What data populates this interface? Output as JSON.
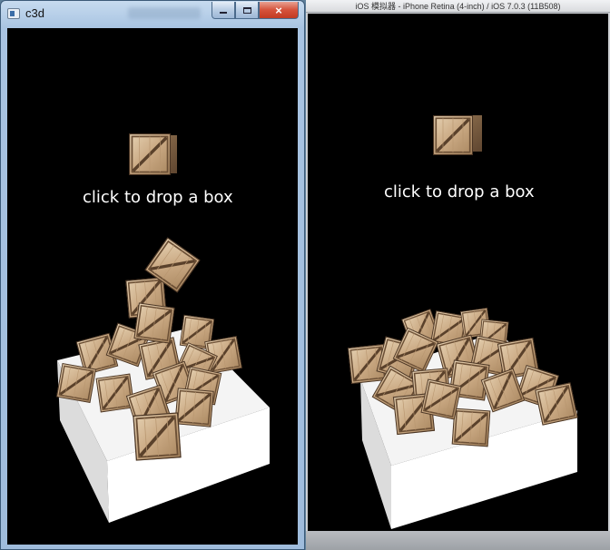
{
  "windows_app": {
    "title": "c3d",
    "controls": {
      "minimize": "minimize",
      "maximize": "maximize",
      "close": "×"
    },
    "prompt": "click to drop a box"
  },
  "ios_simulator": {
    "title": "iOS 模拟器 - iPhone Retina (4-inch) / iOS 7.0.3 (11B508)",
    "prompt": "click to drop a box"
  },
  "colors": {
    "background": "#000000",
    "box_light": "#d9c3a2",
    "box_dark": "#7a5f43",
    "platform": "#ffffff",
    "text": "#ffffff"
  }
}
